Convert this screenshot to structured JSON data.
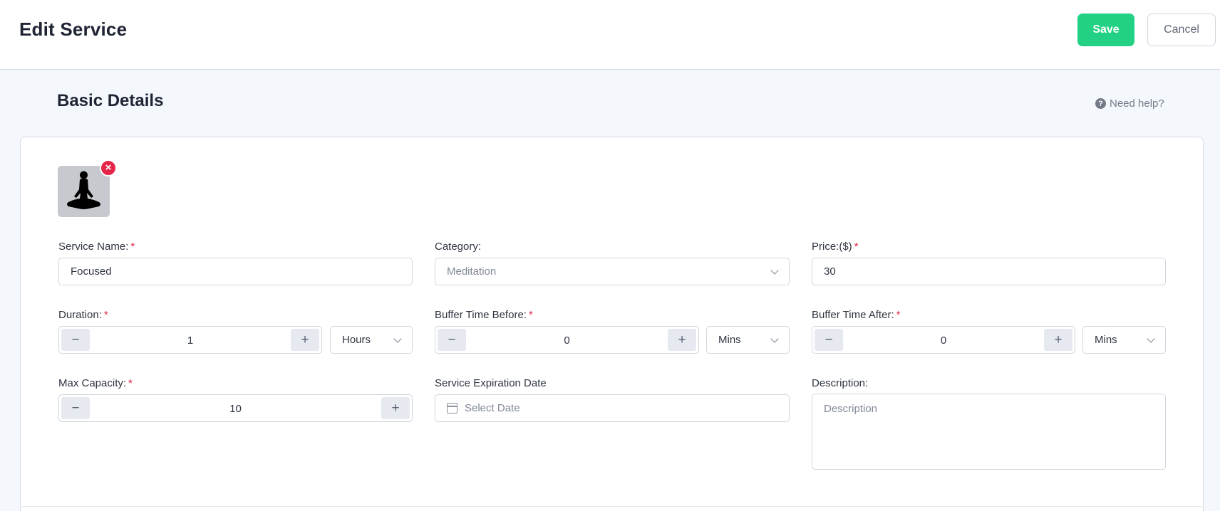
{
  "header": {
    "title": "Edit Service",
    "save_label": "Save",
    "cancel_label": "Cancel"
  },
  "section": {
    "title": "Basic Details",
    "help_label": "Need help?"
  },
  "image": {
    "icon": "meditation-figure",
    "remove": "×"
  },
  "fields": {
    "service_name": {
      "label": "Service Name:",
      "required": "*",
      "value": "Focused"
    },
    "category": {
      "label": "Category:",
      "value": "Meditation"
    },
    "price": {
      "label": "Price:($)",
      "required": "*",
      "value": "30"
    },
    "duration": {
      "label": "Duration:",
      "required": "*",
      "value": "1",
      "unit": "Hours"
    },
    "buffer_before": {
      "label": "Buffer Time Before:",
      "required": "*",
      "value": "0",
      "unit": "Mins"
    },
    "buffer_after": {
      "label": "Buffer Time After:",
      "required": "*",
      "value": "0",
      "unit": "Mins"
    },
    "max_capacity": {
      "label": "Max Capacity:",
      "required": "*",
      "value": "10"
    },
    "expiration": {
      "label": "Service Expiration Date",
      "placeholder": "Select Date"
    },
    "description": {
      "label": "Description:",
      "placeholder": "Description"
    }
  },
  "stepper": {
    "minus": "−",
    "plus": "+"
  },
  "colors": {
    "primary": "#22d184",
    "required": "#e5264a",
    "background": "#f4f7fb"
  }
}
